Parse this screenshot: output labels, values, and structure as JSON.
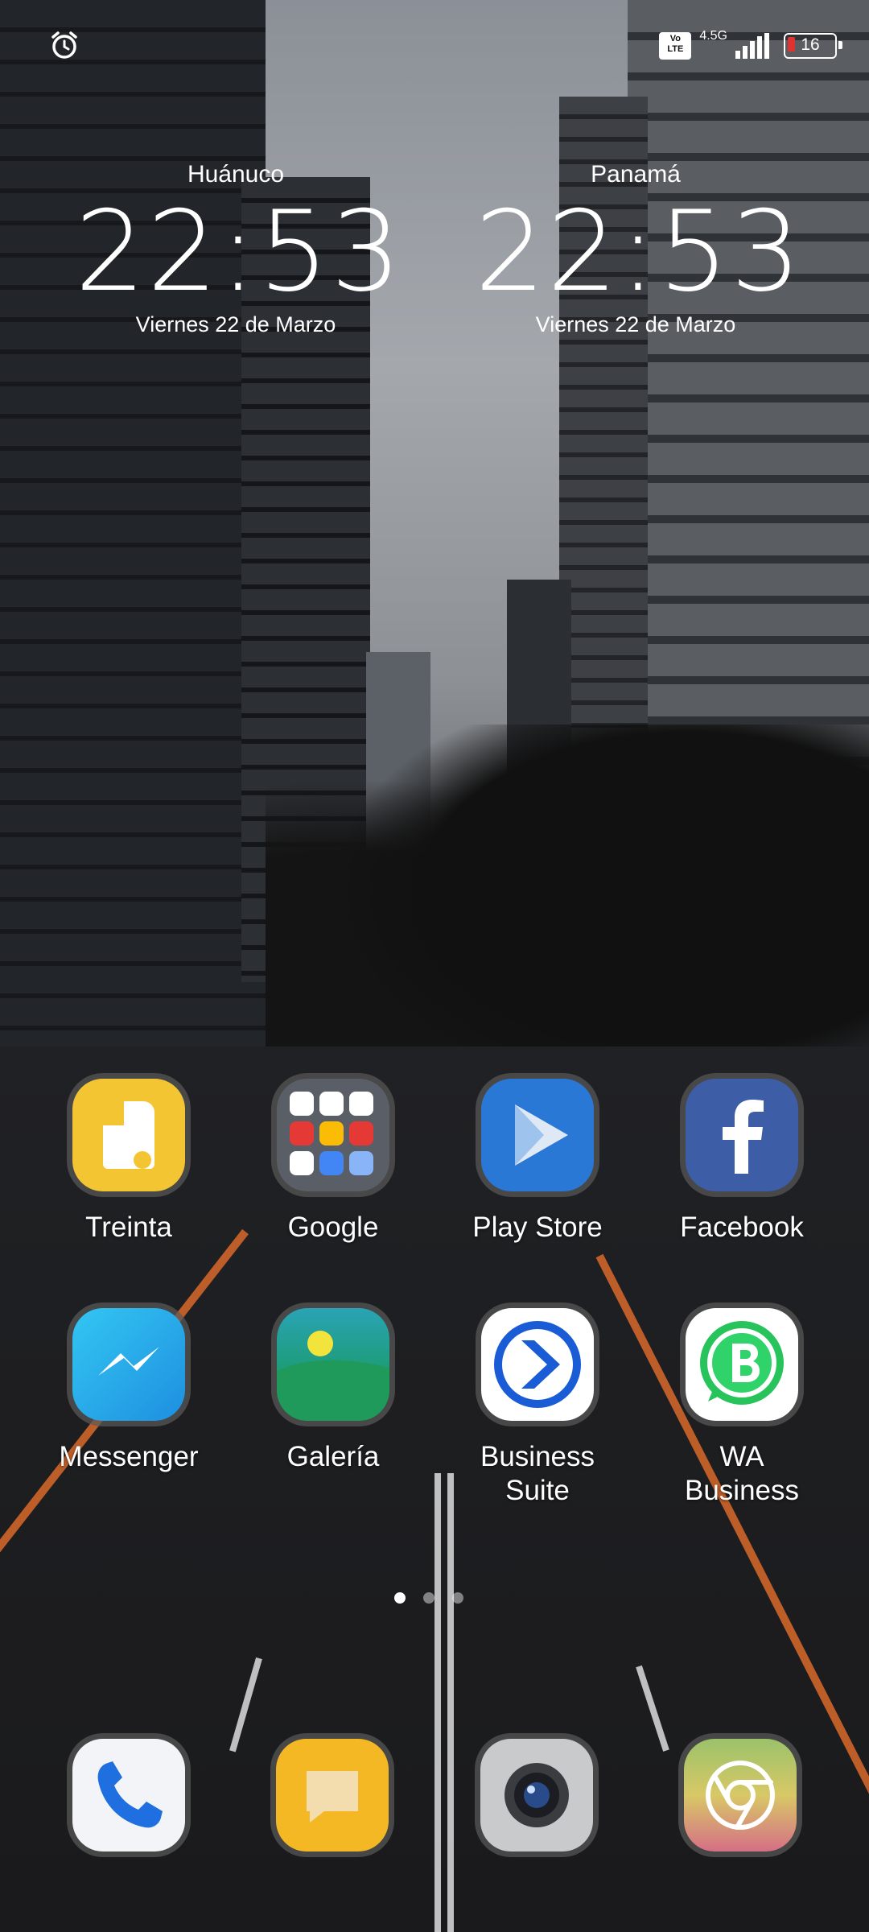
{
  "status_bar": {
    "alarm_icon": "alarm-clock-icon",
    "volte": "Vo LTE",
    "network": "4.5G",
    "battery": "16"
  },
  "clocks": [
    {
      "city": "Huánuco",
      "time": "22:53",
      "date": "Viernes 22 de Marzo"
    },
    {
      "city": "Panamá",
      "time": "22:53",
      "date": "Viernes 22 de Marzo"
    }
  ],
  "apps": {
    "treinta": "Treinta",
    "google": "Google",
    "play_store": "Play Store",
    "facebook": "Facebook",
    "messenger": "Messenger",
    "galeria": "Galería",
    "business_suite": "Business Suite",
    "wa_business": "WA Business"
  },
  "dock": [
    "phone-icon",
    "messages-icon",
    "camera-icon",
    "browser-icon"
  ],
  "pages": {
    "count": 3,
    "current": 1
  }
}
